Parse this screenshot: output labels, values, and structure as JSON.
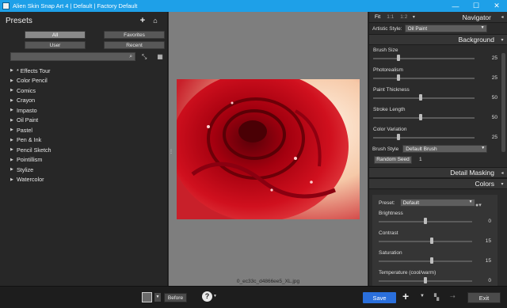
{
  "window": {
    "title": "Alien Skin Snap Art 4 | Default | Factory Default",
    "minimize": "—",
    "maximize": "☐",
    "close": "✕"
  },
  "presets": {
    "title": "Presets",
    "tabs": {
      "all": "All",
      "favorites": "Favorites",
      "user": "User",
      "recent": "Recent"
    },
    "items": [
      "* Effects Tour",
      "Color Pencil",
      "Comics",
      "Crayon",
      "Impasto",
      "Oil Paint",
      "Pastel",
      "Pen & Ink",
      "Pencil Sketch",
      "Pointillism",
      "Stylize",
      "Watercolor"
    ]
  },
  "canvas": {
    "filename": "0_ec33c_d4866ee5_XL.jpg"
  },
  "navigator": {
    "title": "Navigator",
    "zoom": [
      "Fit",
      "1:1",
      "1:2"
    ],
    "artistic_style_label": "Artistic Style:",
    "artistic_style_value": "Oil Paint"
  },
  "background": {
    "title": "Background",
    "sliders": [
      {
        "label": "Brush Size",
        "value": "25",
        "pos": 0.27
      },
      {
        "label": "Photorealism",
        "value": "25",
        "pos": 0.27
      },
      {
        "label": "Paint Thickness",
        "value": "50",
        "pos": 0.5
      },
      {
        "label": "Stroke Length",
        "value": "50",
        "pos": 0.5
      },
      {
        "label": "Color Variation",
        "value": "25",
        "pos": 0.27
      }
    ],
    "brush_style_label": "Brush Style",
    "brush_style_value": "Default Brush",
    "random_seed_label": "Random Seed",
    "random_seed_value": "1"
  },
  "detail_masking": {
    "title": "Detail Masking"
  },
  "colors": {
    "title": "Colors",
    "preset_label": "Preset:",
    "preset_value": "Default",
    "sliders": [
      {
        "label": "Brightness",
        "value": "0",
        "pos": 0.5
      },
      {
        "label": "Contrast",
        "value": "15",
        "pos": 0.57
      },
      {
        "label": "Saturation",
        "value": "15",
        "pos": 0.57
      },
      {
        "label": "Temperature (cool/warm)",
        "value": "0",
        "pos": 0.5
      }
    ]
  },
  "bottom": {
    "before": "Before",
    "help": "?",
    "save": "Save",
    "exit": "Exit"
  }
}
